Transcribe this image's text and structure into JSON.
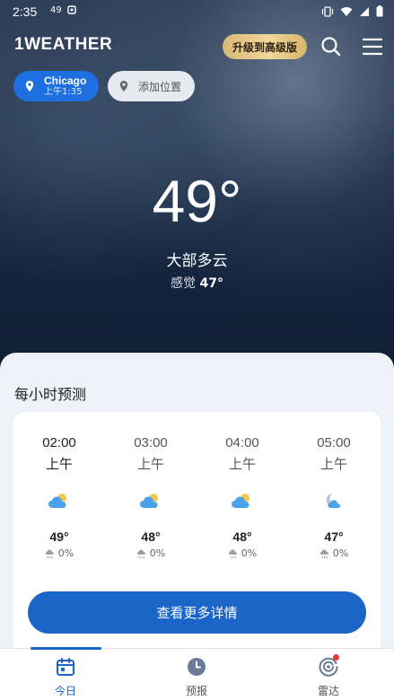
{
  "status_bar": {
    "time": "2:35",
    "left_indicators": [
      "49"
    ]
  },
  "header": {
    "logo": "1WEATHER",
    "upgrade_label": "升级到高级版"
  },
  "locations": {
    "current": {
      "name": "Chicago",
      "time": "上午1:35"
    },
    "add_label": "添加位置"
  },
  "current": {
    "temperature": "49°",
    "condition": "大部多云",
    "feels_label": "感觉",
    "feels_value": "47°"
  },
  "hourly": {
    "title": "每小时预测",
    "items": [
      {
        "time": "02:00",
        "period": "上午",
        "icon": "partly-cloudy-day-icon",
        "temp": "49°",
        "precip": "0%"
      },
      {
        "time": "03:00",
        "period": "上午",
        "icon": "partly-cloudy-day-icon",
        "temp": "48°",
        "precip": "0%"
      },
      {
        "time": "04:00",
        "period": "上午",
        "icon": "partly-cloudy-day-icon",
        "temp": "48°",
        "precip": "0%"
      },
      {
        "time": "05:00",
        "period": "上午",
        "icon": "partly-cloudy-night-icon",
        "temp": "47°",
        "precip": "0%"
      }
    ],
    "more_label": "查看更多详情"
  },
  "nav": {
    "today": "今日",
    "forecast": "预报",
    "radar": "雷达"
  },
  "colors": {
    "accent": "#1b64c8",
    "chip_active": "#1e6fe0",
    "upgrade_gold": "#e8cc8a",
    "notification": "#e53935"
  }
}
